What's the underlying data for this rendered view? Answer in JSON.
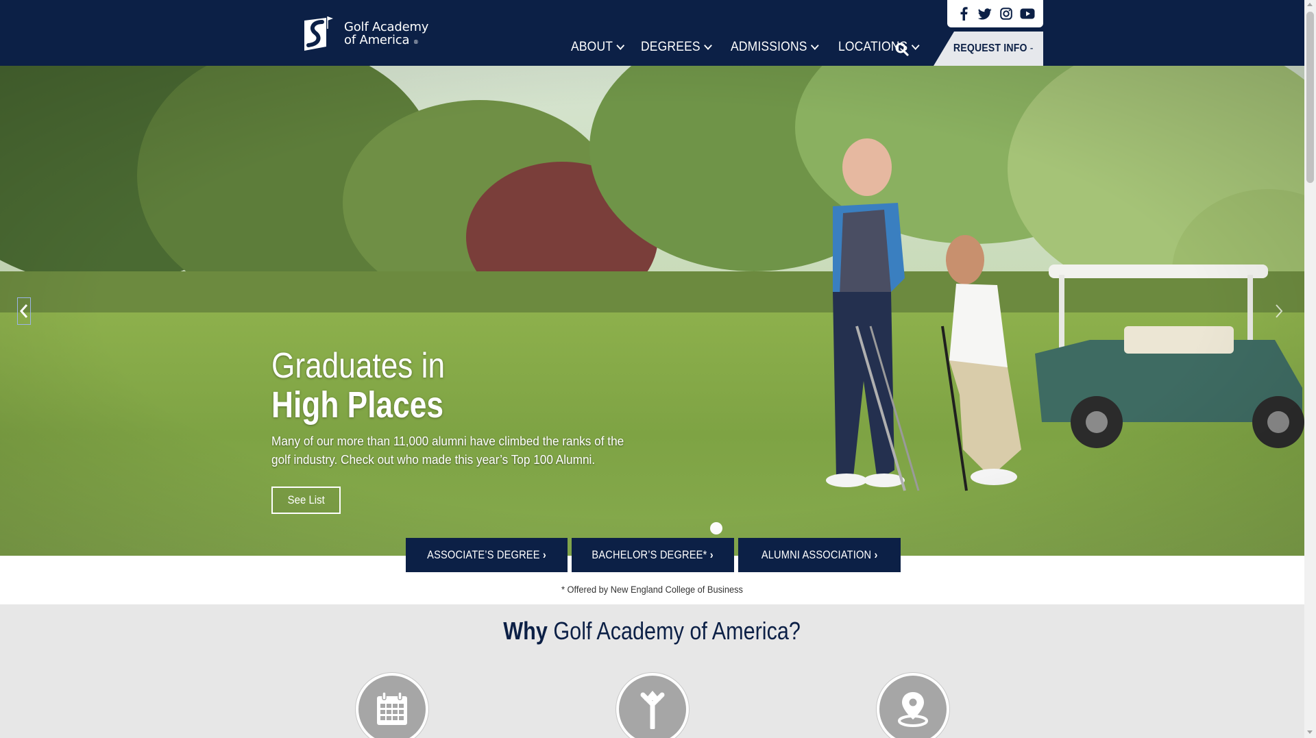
{
  "brand": {
    "line1": "Golf Academy",
    "line2": "of America",
    "reg": "®"
  },
  "nav": {
    "items": [
      {
        "label": "ABOUT"
      },
      {
        "label": "DEGREES"
      },
      {
        "label": "ADMISSIONS"
      },
      {
        "label": "LOCATIONS"
      }
    ],
    "search_icon": "search-icon",
    "request_info": "REQUEST INFO",
    "request_info_suffix": "-"
  },
  "social": [
    "facebook-icon",
    "twitter-icon",
    "instagram-icon",
    "youtube-icon"
  ],
  "hero": {
    "title_line1": "Graduates in",
    "title_line2": "High Places",
    "description": "Many of our more than 11,000 alumni have climbed the ranks of the golf industry. Check out who made this year’s Top 100 Alumni.",
    "button": "See List"
  },
  "degrees": {
    "associate": "ASSOCIATE’S DEGREE",
    "bachelor": "BACHELOR’S DEGREE*",
    "alumni": "ALUMNI ASSOCIATION",
    "chevron": "›",
    "footnote": "* Offered by New England College of Business"
  },
  "why": {
    "title_bold": "Why",
    "title_rest": "Golf Academy of America?",
    "icons": [
      "calendar-icon",
      "fork-arrows-icon",
      "location-pin-icon"
    ]
  },
  "colors": {
    "navy": "#0c2046",
    "light_gray": "#e7e7e7",
    "icon_gray": "#a6a6a6"
  }
}
